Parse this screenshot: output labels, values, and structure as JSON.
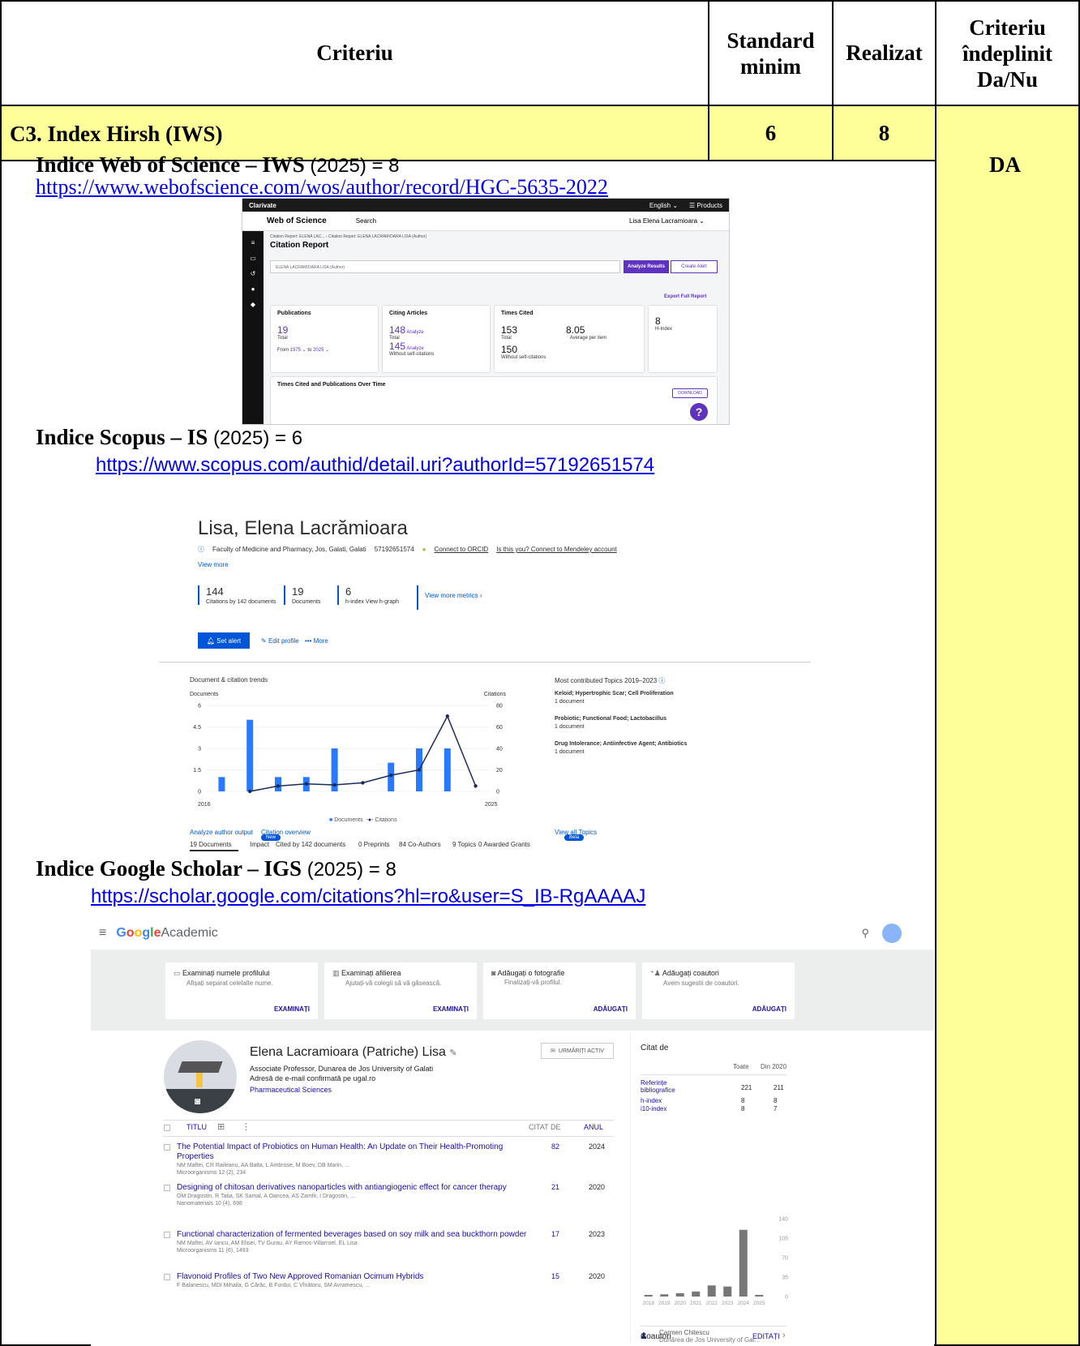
{
  "header": {
    "criteriu": "Criteriu",
    "standard": "Standard minim",
    "realizat": "Realizat",
    "indeplinit": "Criteriu îndeplinit Da/Nu"
  },
  "row": {
    "label": "C3. Index Hirsh (IWS)",
    "standard_value": "6",
    "realizat_value": "8",
    "verdict": "DA"
  },
  "wos": {
    "title_bold": "Indice Web of Science – IWS",
    "title_rest": " (2025) = 8",
    "url": "https://www.webofscience.com/wos/author/record/HGC-5635-2022",
    "shot": {
      "brand": "Clarivate",
      "lang": "English ⌄",
      "products": "☰ Products",
      "app": "Web of Science",
      "search": "Search",
      "user": "Lisa Elena Lacramioara ⌄",
      "breadcrumb": "Citation Report: ELENA LAC... › Citation Report: ELENA LACRAMIOARA LISA (Author)",
      "page_title": "Citation Report",
      "query": "ELENA LACRAMIOARA LISA (Author)",
      "analyze": "Analyze Results",
      "alert": "Create Alert",
      "export": "Export Full Report",
      "publications": {
        "label": "Publications",
        "value": "19",
        "sub": "Total",
        "from": "From",
        "from_v": "1975 ⌄",
        "to": "to",
        "to_v": "2025 ⌄"
      },
      "citing": {
        "label": "Citing Articles",
        "v1": "148",
        "v1_sub": "Total",
        "v2": "145",
        "v2_sub": "Without self-citations",
        "analyze": "Analyze"
      },
      "times": {
        "label": "Times Cited",
        "v1": "153",
        "v1_sub": "Total",
        "avg": "8.05",
        "avg_sub": "Average per item",
        "v2": "150",
        "v2_sub": "Without self-citations"
      },
      "hindex": {
        "value": "8",
        "label": "H-Index"
      },
      "over_time": "Times Cited and Publications Over Time",
      "download": "DOWNLOAD"
    }
  },
  "scopus": {
    "title_bold": "Indice Scopus – IS",
    "title_rest": " (2025) = 6",
    "url": "https://www.scopus.com/authid/detail.uri?authorId=57192651574",
    "shot": {
      "name": "Lisa, Elena Lacrămioara",
      "affil": "Faculty of Medicine and Pharmacy, Jos, Galati, Galati",
      "auth_id": "57192651574",
      "orcid": "Connect to ORCID",
      "mendeley": "Is this you? Connect to Mendeley account",
      "view_more": "View more",
      "m1_v": "144",
      "m1_l": "Citations by 142 documents",
      "m2_v": "19",
      "m2_l": "Documents",
      "m3_v": "6",
      "m3_l": "h-index View h-graph",
      "more_metrics": "View more metrics ›",
      "set_alert": "Set alert",
      "edit_profile": "Edit profile",
      "more": "••• More",
      "trends": "Document & citation trends",
      "docs_axis": "Documents",
      "cit_axis": "Citations",
      "x_start": "2016",
      "x_end": "2025",
      "legend_docs": "Documents",
      "legend_cit": "Citations",
      "analyze_output": "Analyze author output",
      "citation_overview": "Citation overview",
      "topics_title": "Most contributed Topics 2019–2023",
      "topics": [
        {
          "name": "Keloid; Hypertrophic Scar; Cell Proliferation",
          "count": "1 document"
        },
        {
          "name": "Probiotic; Functional Food; Lactobacillus",
          "count": "1 document"
        },
        {
          "name": "Drug Intolerance; Antiinfective Agent; Antibiotics",
          "count": "1 document"
        }
      ],
      "view_topics": "View all Topics",
      "new_badge": "New",
      "beta_badge": "Beta",
      "tabs": [
        "19 Documents",
        "Impact",
        "Cited by 142 documents",
        "0 Preprints",
        "84 Co-Authors",
        "9 Topics",
        "0 Awarded Grants"
      ]
    }
  },
  "gscholar": {
    "title_bold": "Indice Google Scholar – IGS",
    "title_rest": " (2025) = 8",
    "url": "https://scholar.google.com/citations?hl=ro&user=S_IB-RgAAAAJ",
    "shot": {
      "app_google": "Google",
      "app_name": " Academic",
      "cards": [
        {
          "title": "Examinați numele profilului",
          "sub": "Afișați separat celelalte nume.",
          "action": "EXAMINAȚI"
        },
        {
          "title": "Examinați afilierea",
          "sub": "Ajutați-vă colegii să vă găsească.",
          "action": "EXAMINAȚI"
        },
        {
          "title": "Adăugați o fotografie",
          "sub": "Finalizați-vă profilul.",
          "action": "ADĂUGAȚI"
        },
        {
          "title": "Adăugați coautori",
          "sub": "Avem sugestii de coautori.",
          "action": "ADĂUGAȚI"
        }
      ],
      "profile_name": "Elena Lacramioara (Patriche) Lisa",
      "position": "Associate Professor, Dunarea de Jos University of Galati",
      "email": "Adresă de e-mail confirmată pe ugal.ro",
      "interest": "Pharmaceutical Sciences",
      "follow": "URMĂRIȚI ACTIV",
      "col_title": "TITLU",
      "col_cited": "CITAT DE",
      "col_year": "ANUL",
      "articles": [
        {
          "title": "The Potential Impact of Probiotics on Human Health: An Update on Their Health-Promoting Properties",
          "authors": "NM Maftei, CR Raileanu, AA Balta, L Ambrose, M Boev, DB Marin, ...",
          "venue": "Microorganisms 12 (2), 234",
          "cited": "82",
          "year": "2024"
        },
        {
          "title": "Designing of chitosan derivatives nanoparticles with antiangiogenic effect for cancer therapy",
          "authors": "OM Dragostin, R Tatia, SK Samal, A Oancea, AS Zamfir, I Dragostin, ...",
          "venue": "Nanomaterials 10 (4), 698",
          "cited": "21",
          "year": "2020"
        },
        {
          "title": "Functional characterization of fermented beverages based on soy milk and sea buckthorn powder",
          "authors": "NM Maftei, AV Iancu, AM Elisei, TV Gurau, AY Ramos-Villarroel, EL Lisa",
          "venue": "Microorganisms 11 (6), 1493",
          "cited": "17",
          "year": "2023"
        },
        {
          "title": "Flavonoid Profiles of Two New Approved Romanian Ocimum Hybrids",
          "authors": "F Balanescu, MDI Mihaila, G Cârâc, B Furdui, C Vînătoru, SM Avramescu, ...",
          "venue": "",
          "cited": "15",
          "year": "2020"
        }
      ],
      "cited_by": "Citat de",
      "col_all": "Toate",
      "col_since": "Din 2020",
      "stats": [
        {
          "label": "Referințe bibliografice",
          "all": "221",
          "since": "211"
        },
        {
          "label": "h-index",
          "all": "8",
          "since": "8"
        },
        {
          "label": "i10-index",
          "all": "8",
          "since": "7"
        }
      ],
      "coauthors": "Coautori",
      "edit": "EDITAȚI",
      "coauthor_name": "Carmen Chitescu",
      "coauthor_aff": "Dunărea de Jos University of Gal..."
    }
  },
  "chart_data": [
    {
      "type": "bar",
      "title": "Document & citation trends",
      "categories": [
        "2016",
        "2017",
        "2018",
        "2019",
        "2020",
        "2021",
        "2022",
        "2023",
        "2024",
        "2025"
      ],
      "series": [
        {
          "name": "Documents",
          "values": [
            1,
            5,
            1,
            1,
            3,
            0,
            2,
            3,
            3,
            0
          ]
        },
        {
          "name": "Citations",
          "values": [
            null,
            0,
            5,
            7,
            6,
            8,
            15,
            20,
            70,
            5
          ]
        }
      ],
      "ylabel": "Documents",
      "y2label": "Citations",
      "ylim": [
        0,
        6
      ],
      "y2lim": [
        0,
        80
      ],
      "yticks": [
        "0",
        "1.5",
        "3",
        "4.5",
        "6"
      ],
      "y2ticks": [
        "0",
        "20",
        "40",
        "60",
        "80"
      ]
    },
    {
      "type": "bar",
      "categories": [
        "2018",
        "2019",
        "2020",
        "2021",
        "2022",
        "2023",
        "2024",
        "2025"
      ],
      "values": [
        3,
        4,
        6,
        9,
        20,
        18,
        120,
        3
      ],
      "ylim": [
        0,
        140
      ],
      "yticks": [
        "0",
        "35",
        "70",
        "105",
        "140"
      ]
    }
  ]
}
